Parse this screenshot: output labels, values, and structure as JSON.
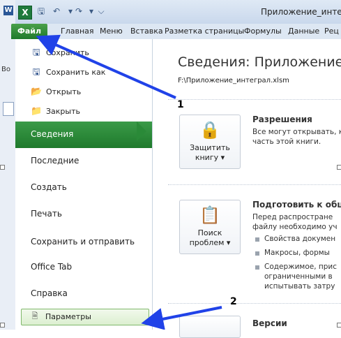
{
  "window": {
    "title": "Приложение_интег",
    "app_icon": "X",
    "word_icon": "W",
    "bg_fragment": "Во"
  },
  "quick_access": {
    "icons": [
      "save-icon",
      "undo-icon",
      "redo-icon",
      "customize-icon"
    ]
  },
  "ribbon": {
    "file_tab": "Файл",
    "tabs": [
      "Главная",
      "Меню",
      "Вставка",
      "Разметка страницы",
      "Формулы",
      "Данные",
      "Рец"
    ]
  },
  "backstage": {
    "commands": [
      {
        "label": "Сохранить",
        "icon": "save-icon"
      },
      {
        "label": "Сохранить как",
        "icon": "save-as-icon"
      },
      {
        "label": "Открыть",
        "icon": "open-folder-icon"
      },
      {
        "label": "Закрыть",
        "icon": "close-folder-icon"
      }
    ],
    "nav": [
      {
        "label": "Сведения",
        "selected": true
      },
      {
        "label": "Последние",
        "selected": false
      },
      {
        "label": "Создать",
        "selected": false
      },
      {
        "label": "Печать",
        "selected": false
      },
      {
        "label": "Сохранить и отправить",
        "selected": false
      },
      {
        "label": "Office Tab",
        "selected": false
      },
      {
        "label": "Справка",
        "selected": false
      }
    ],
    "params": {
      "label": "Параметры",
      "icon": "options-icon"
    }
  },
  "info": {
    "title": "Сведения: Приложение_",
    "path": "F:\\Приложение_интеграл.xlsm",
    "protect": {
      "button_line1": "Защитить",
      "button_line2": "книгу ▾",
      "heading": "Разрешения",
      "text_line1": "Все могут открывать, к",
      "text_line2": "часть этой книги."
    },
    "check": {
      "button_line1": "Поиск",
      "button_line2": "проблем ▾",
      "heading": "Подготовить к общ",
      "text_line1": "Перед распростране",
      "text_line2": "файлу необходимо уч",
      "bullets": [
        "Свойства докумен",
        "Макросы, формы",
        "Содержимое, прис",
        "ограниченными в",
        "испытывать затру"
      ]
    },
    "versions": {
      "heading": "Версии"
    }
  },
  "annotations": {
    "label_1": "1",
    "label_2": "2",
    "arrow_color": "#2042e8"
  },
  "colors": {
    "file_green": "#1f7a2c",
    "selected_green": "#2a8a38"
  }
}
